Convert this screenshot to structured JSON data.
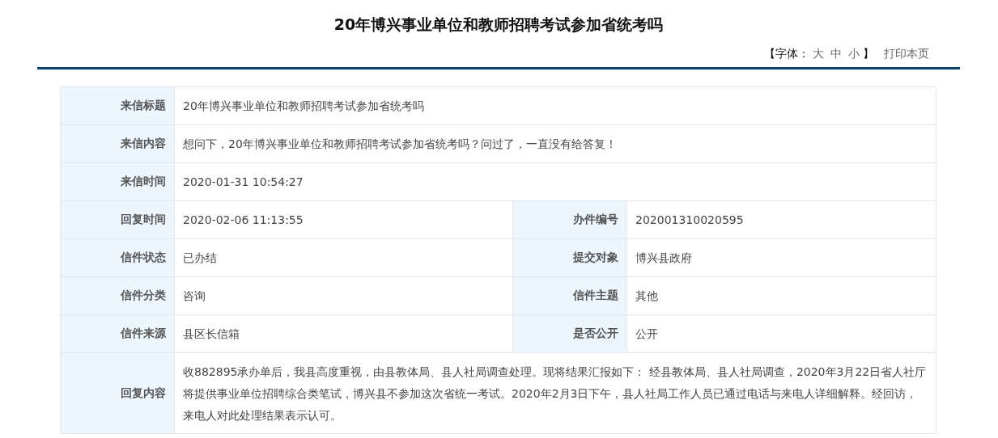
{
  "title": "20年博兴事业单位和教师招聘考试参加省统考吗",
  "toolbar": {
    "font_label_open": "【字体：",
    "font_sizes": [
      "大",
      "中",
      "小"
    ],
    "font_label_close": "】",
    "print": "打印本页"
  },
  "rows": [
    {
      "kind": "full",
      "cells": [
        {
          "label": "来信标题",
          "value": "20年博兴事业单位和教师招聘考试参加省统考吗"
        }
      ]
    },
    {
      "kind": "full",
      "cells": [
        {
          "label": "来信内容",
          "value": "想问下，20年博兴事业单位和教师招聘考试参加省统考吗？问过了，一直没有给答复！"
        }
      ]
    },
    {
      "kind": "full",
      "cells": [
        {
          "label": "来信时间",
          "value": "2020-01-31 10:54:27"
        }
      ]
    },
    {
      "kind": "pair",
      "cells": [
        {
          "label": "回复时间",
          "value": "2020-02-06 11:13:55"
        },
        {
          "label": "办件编号",
          "value": "202001310020595"
        }
      ]
    },
    {
      "kind": "pair",
      "cells": [
        {
          "label": "信件状态",
          "value": "已办结"
        },
        {
          "label": "提交对象",
          "value": "博兴县政府"
        }
      ]
    },
    {
      "kind": "pair",
      "cells": [
        {
          "label": "信件分类",
          "value": "咨询"
        },
        {
          "label": "信件主题",
          "value": "其他"
        }
      ]
    },
    {
      "kind": "pair",
      "cells": [
        {
          "label": "信件来源",
          "value": "县区长信箱"
        },
        {
          "label": "是否公开",
          "value": "公开"
        }
      ]
    },
    {
      "kind": "full",
      "cells": [
        {
          "label": "回复内容",
          "value": "收882895承办单后，我县高度重视，由县教体局、县人社局调查处理。现将结果汇报如下： 经县教体局、县人社局调查，2020年3月22日省人社厅将提供事业单位招聘综合类笔试，博兴县不参加这次省统一考试。2020年2月3日下午，县人社局工作人员已通过电话与来电人详细解释。经回访，来电人对此处理结果表示认可。"
        }
      ]
    }
  ]
}
